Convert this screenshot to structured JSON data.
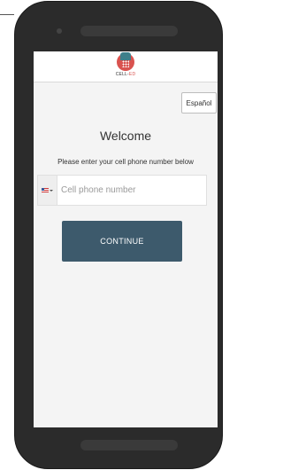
{
  "brand": {
    "logo_text_prefix": "CELL-",
    "logo_text_suffix": "ED",
    "accent_red": "#d9534f",
    "accent_teal": "#3d7f8a"
  },
  "header": {
    "language_button_label": "Español"
  },
  "main": {
    "title": "Welcome",
    "instructions": "Please enter your cell phone number below",
    "phone_field": {
      "placeholder": "Cell phone number",
      "value": "",
      "country_flag_icon": "us-flag-icon"
    },
    "continue_label": "CONTINUE",
    "continue_color": "#3d5a6c"
  }
}
